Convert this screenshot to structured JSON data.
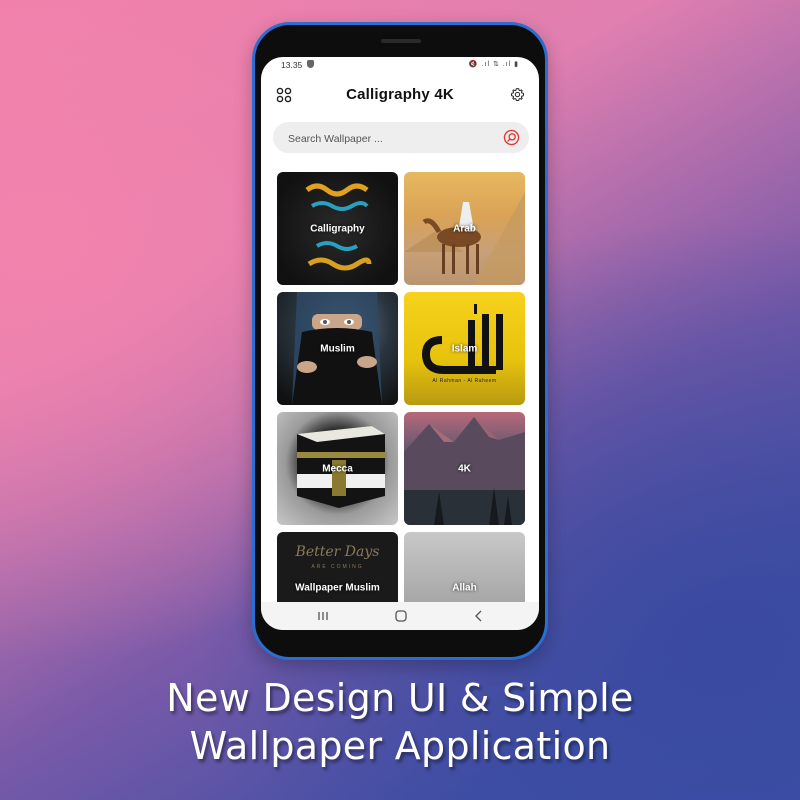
{
  "status_bar": {
    "time": "13.35",
    "icons": [
      "shield-icon",
      "mute-icon",
      "signal-icon",
      "wifi-icon",
      "signal-icon",
      "battery-icon"
    ],
    "icons_text": "🔇 .ıl ⇅ .ıl ▮"
  },
  "header": {
    "title": "Calligraphy 4K",
    "menu_icon": "grid-menu-icon",
    "settings_icon": "gear-icon"
  },
  "search": {
    "placeholder": "Search Wallpaper ...",
    "value": "",
    "icon": "search-icon",
    "accent_color": "#e53935"
  },
  "categories": [
    {
      "label": "Calligraphy"
    },
    {
      "label": "Arab"
    },
    {
      "label": "Muslim"
    },
    {
      "label": "Islam"
    },
    {
      "label": "Mecca"
    },
    {
      "label": "4K"
    },
    {
      "label": "Wallpaper Muslim"
    },
    {
      "label": "Allah"
    }
  ],
  "card_text": {
    "islam_sub": "Al Rahman - Al Raheem",
    "wallpaper_muslim_script": "Better Days",
    "wallpaper_muslim_sub": "ARE COMING"
  },
  "nav_bar": {
    "recents_icon": "recents-icon",
    "home_icon": "home-icon",
    "back_icon": "back-icon"
  },
  "caption": {
    "line1": "New Design UI & Simple",
    "line2": "Wallpaper Application"
  },
  "colors": {
    "phone_frame": "#2b6dd0",
    "background_top": "#f080aa",
    "background_bottom": "#3a4ea8"
  }
}
